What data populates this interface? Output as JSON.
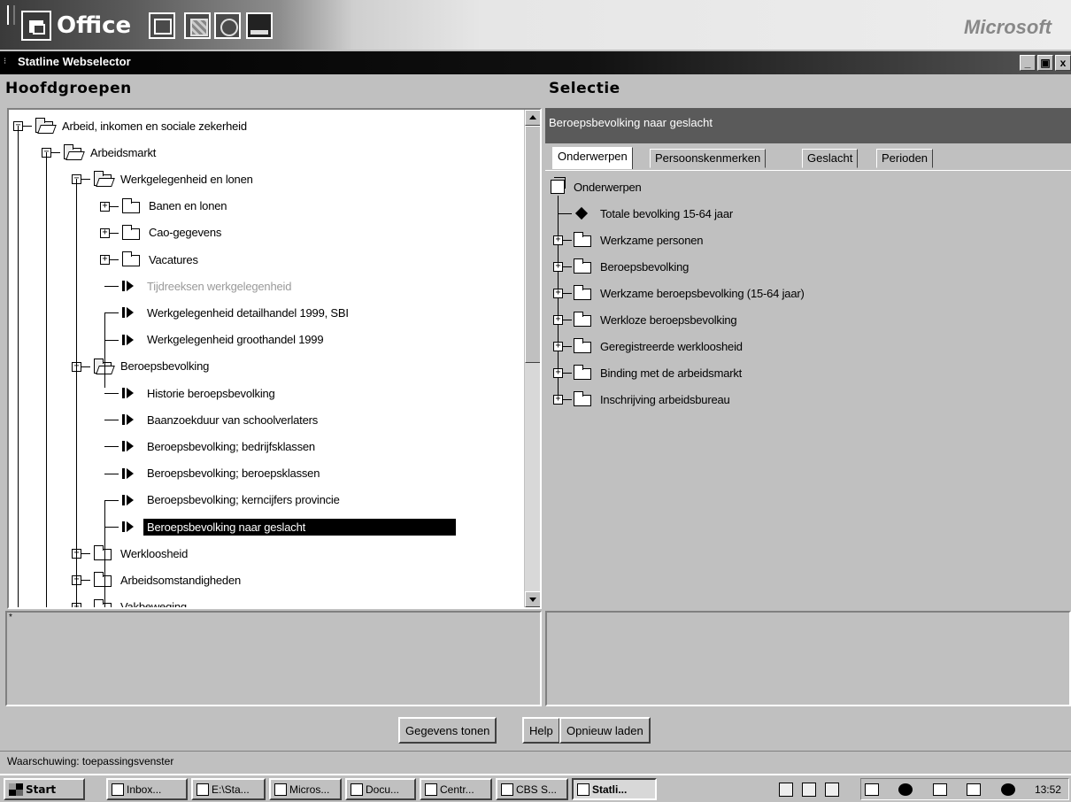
{
  "office_bar": {
    "logo_text": "Office",
    "brand": "Microsoft"
  },
  "window": {
    "title": "Statline Webselector",
    "controls": [
      "_",
      "̅□",
      "x"
    ]
  },
  "left_panel": {
    "header": "Hoofdgroepen",
    "tree": [
      {
        "label": "Arbeid, inkomen en sociale zekerheid",
        "icon": "folder-open-icon",
        "level": 0
      },
      {
        "label": "Arbeidsmarkt",
        "icon": "folder-open-icon",
        "level": 1
      },
      {
        "label": "Werkgelegenheid en lonen",
        "icon": "folder-open-icon",
        "level": 2
      },
      {
        "label": "Banen en lonen",
        "icon": "folder-icon",
        "level": 3
      },
      {
        "label": "Cao-gegevens",
        "icon": "folder-icon",
        "level": 3
      },
      {
        "label": "Vacatures",
        "icon": "folder-icon",
        "level": 3
      },
      {
        "label": "Tijdreeksen werkgelegenheid",
        "icon": "table-icon",
        "level": 3,
        "disabled": true
      },
      {
        "label": "Werkgelegenheid detailhandel 1999, SBI",
        "icon": "table-icon",
        "level": 3
      },
      {
        "label": "Werkgelegenheid groothandel 1999",
        "icon": "table-icon",
        "level": 3
      },
      {
        "label": "Beroepsbevolking",
        "icon": "folder-open-icon",
        "level": 2
      },
      {
        "label": "Historie beroepsbevolking",
        "icon": "table-icon",
        "level": 3
      },
      {
        "label": "Baanzoekduur van schoolverlaters",
        "icon": "table-icon",
        "level": 3
      },
      {
        "label": "Beroepsbevolking; bedrijfsklassen",
        "icon": "table-icon",
        "level": 3
      },
      {
        "label": "Beroepsbevolking; beroepsklassen",
        "icon": "table-icon",
        "level": 3
      },
      {
        "label": "Beroepsbevolking; kerncijfers provincie",
        "icon": "table-icon",
        "level": 3
      },
      {
        "label": "Beroepsbevolking naar geslacht",
        "icon": "table-icon",
        "level": 3,
        "selected": true
      },
      {
        "label": "Werkloosheid",
        "icon": "folder-icon",
        "level": 2
      },
      {
        "label": "Arbeidsomstandigheden",
        "icon": "folder-icon",
        "level": 2
      },
      {
        "label": "Vakbeweging",
        "icon": "folder-icon",
        "level": 2
      }
    ]
  },
  "right_panel": {
    "header": "Selectie",
    "title": "Beroepsbevolking naar geslacht",
    "tabs": [
      "Onderwerpen",
      "Persoonskenmerken",
      "Geslacht",
      "Perioden"
    ],
    "active_tab": "Onderwerpen",
    "tree_root": "Onderwerpen",
    "tree": [
      {
        "label": "Totale bevolking 15-64 jaar",
        "icon": "diamond-icon"
      },
      {
        "label": "Werkzame personen",
        "icon": "folder-icon"
      },
      {
        "label": "Beroepsbevolking",
        "icon": "folder-icon"
      },
      {
        "label": "Werkzame beroepsbevolking (15-64 jaar)",
        "icon": "folder-icon"
      },
      {
        "label": "Werkloze beroepsbevolking",
        "icon": "folder-icon"
      },
      {
        "label": "Geregistreerde werkloosheid",
        "icon": "folder-icon"
      },
      {
        "label": "Binding met de arbeidsmarkt",
        "icon": "folder-icon"
      },
      {
        "label": "Inschrijving arbeidsbureau",
        "icon": "folder-icon"
      }
    ]
  },
  "buttons": {
    "show_data": "Gegevens tonen",
    "help": "Help",
    "reload": "Opnieuw laden"
  },
  "status": {
    "text": "Waarschuwing: toepassingsvenster"
  },
  "taskbar": {
    "start": "Start",
    "items": [
      "Inbox...",
      "E:\\Sta...",
      "Micros...",
      "Docu...",
      "Centr...",
      "CBS S...",
      "Statli..."
    ],
    "active_item": "Statli...",
    "clock": "13:52"
  }
}
